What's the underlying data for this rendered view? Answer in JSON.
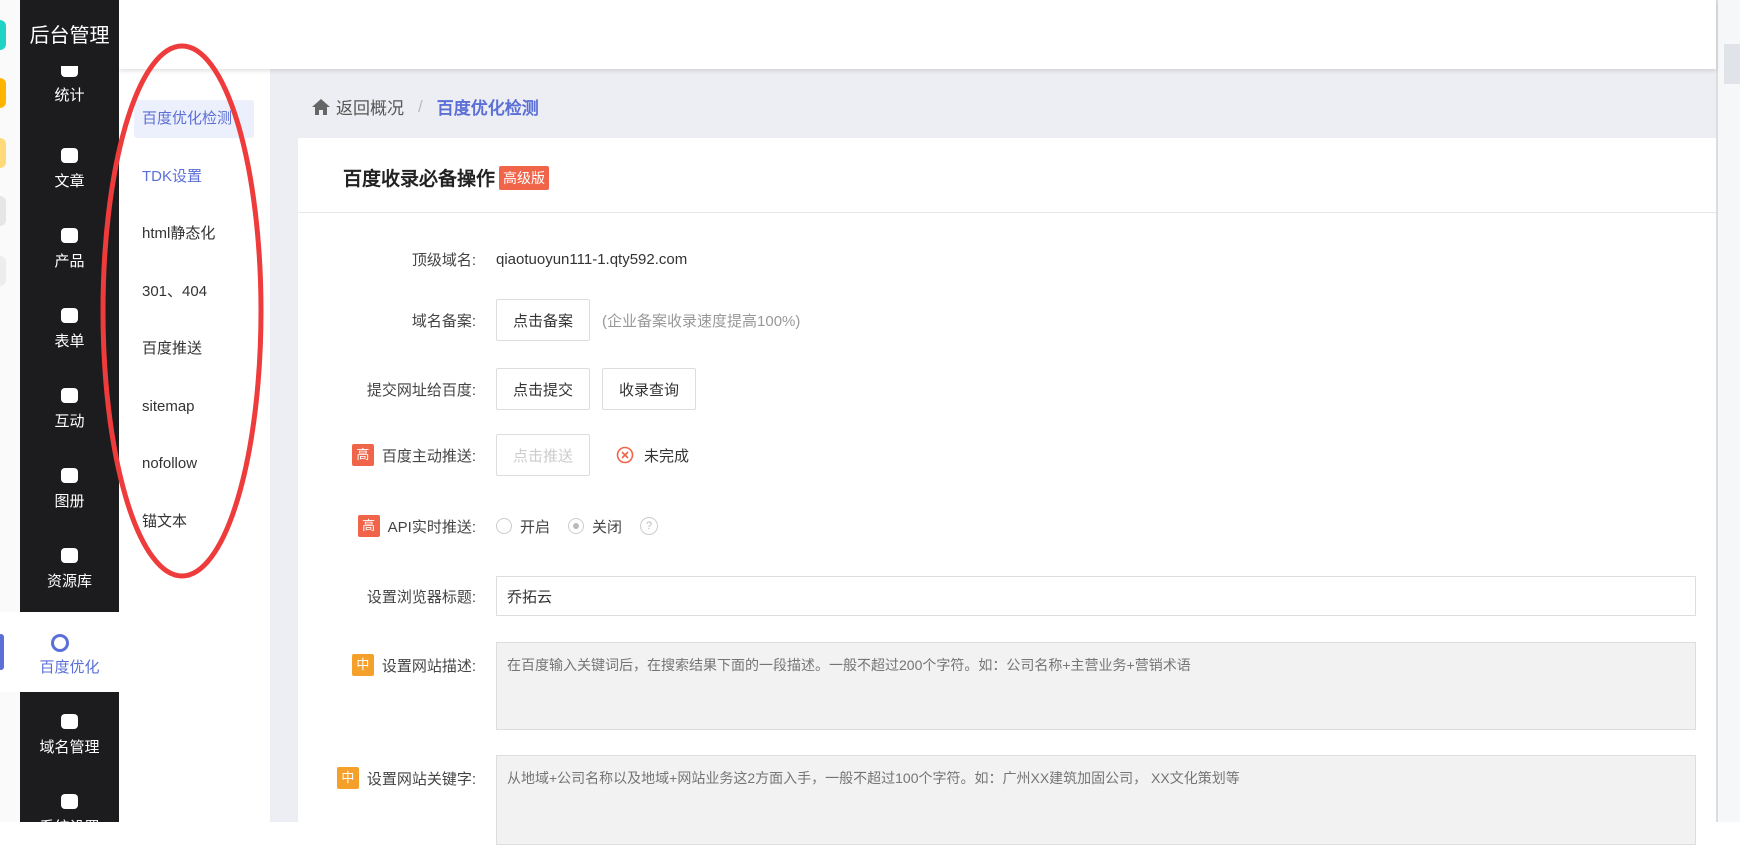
{
  "app": {
    "title": "后台管理"
  },
  "sidebar": {
    "items": [
      {
        "label": "统计",
        "icon": "chart-icon"
      },
      {
        "label": "文章",
        "icon": "article-icon"
      },
      {
        "label": "产品",
        "icon": "grid-icon"
      },
      {
        "label": "表单",
        "icon": "form-icon"
      },
      {
        "label": "互动",
        "icon": "chat-icon"
      },
      {
        "label": "图册",
        "icon": "album-icon"
      },
      {
        "label": "资源库",
        "icon": "database-icon"
      },
      {
        "label": "百度优化",
        "icon": "target-icon",
        "active": true
      },
      {
        "label": "域名管理",
        "icon": "domain-icon"
      },
      {
        "label": "系统设置",
        "icon": "gear-icon"
      }
    ]
  },
  "submenu": {
    "items": [
      "百度优化检测",
      "TDK设置",
      "html静态化",
      "301、404",
      "百度推送",
      "sitemap",
      "nofollow",
      "锚文本"
    ]
  },
  "breadcrumb": {
    "back": "返回概况",
    "separator": "/",
    "current": "百度优化检测"
  },
  "card": {
    "title": "百度收录必备操作",
    "badge": "高级版"
  },
  "form": {
    "domain_label": "顶级域名:",
    "domain_value": "qiaotuoyun111-1.qty592.com",
    "icp_label": "域名备案:",
    "icp_button": "点击备案",
    "icp_hint": "(企业备案收录速度提高100%)",
    "submit_label": "提交网址给百度:",
    "submit_button": "点击提交",
    "query_button": "收录查询",
    "push_level": "高",
    "push_label": "百度主动推送:",
    "push_button": "点击推送",
    "push_status": "未完成",
    "api_level": "高",
    "api_label": "API实时推送:",
    "api_on": "开启",
    "api_off": "关闭",
    "help": "?",
    "title_label": "设置浏览器标题:",
    "title_value": "乔拓云",
    "desc_level": "中",
    "desc_label": "设置网站描述:",
    "desc_placeholder": "在百度输入关键词后，在搜索结果下面的一段描述。一般不超过200个字符。如：公司名称+主营业务+营销术语",
    "kw_level": "中",
    "kw_label": "设置网站关键字:",
    "kw_placeholder": "从地域+公司名称以及地域+网站业务这2方面入手，一般不超过100个字符。如：广州XX建筑加固公司， XX文化策划等"
  },
  "colors": {
    "accent": "#5b6fd6",
    "high": "#f0644a",
    "mid": "#f5a02b",
    "sidebar": "#1c1c1e",
    "annotation": "#ee3b3b"
  }
}
